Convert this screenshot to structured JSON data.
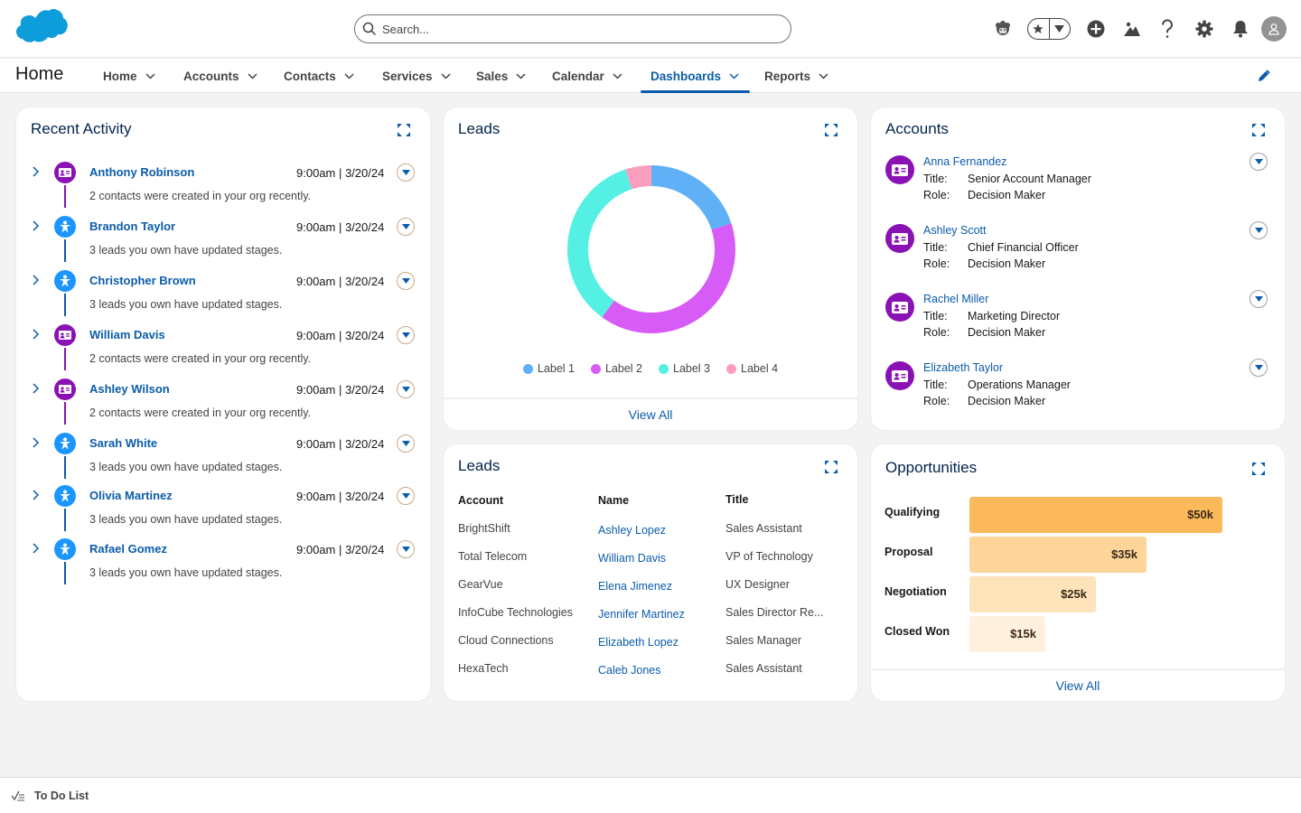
{
  "header": {
    "search_placeholder": "Search...",
    "icons": [
      "einstein-icon",
      "favorites-star-icon",
      "favorites-dropdown-icon",
      "add-icon",
      "trailhead-icon",
      "help-icon",
      "settings-icon",
      "notifications-bell-icon",
      "user-avatar-icon"
    ]
  },
  "nav": {
    "app_name": "Home",
    "items": [
      {
        "label": "Home"
      },
      {
        "label": "Accounts"
      },
      {
        "label": "Contacts"
      },
      {
        "label": "Services"
      },
      {
        "label": "Sales"
      },
      {
        "label": "Calendar"
      },
      {
        "label": "Dashboards",
        "active": true
      },
      {
        "label": "Reports"
      }
    ]
  },
  "recent_activity": {
    "title": "Recent Activity",
    "items": [
      {
        "name": "Anthony Robinson",
        "time": "9:00am | 3/20/24",
        "desc": "2 contacts were created in your org recently.",
        "type": "contact"
      },
      {
        "name": "Brandon Taylor",
        "time": "9:00am | 3/20/24",
        "desc": "3 leads you own have updated stages.",
        "type": "lead"
      },
      {
        "name": "Christopher Brown",
        "time": "9:00am | 3/20/24",
        "desc": "3 leads you own have updated stages.",
        "type": "lead"
      },
      {
        "name": "William Davis",
        "time": "9:00am | 3/20/24",
        "desc": "2 contacts were created in your org recently.",
        "type": "contact"
      },
      {
        "name": "Ashley Wilson",
        "time": "9:00am | 3/20/24",
        "desc": "2 contacts were created in your org recently.",
        "type": "contact"
      },
      {
        "name": "Sarah White",
        "time": "9:00am | 3/20/24",
        "desc": "3 leads you own have updated stages.",
        "type": "lead"
      },
      {
        "name": "Olivia Martinez",
        "time": "9:00am | 3/20/24",
        "desc": "3 leads you own have updated stages.",
        "type": "lead"
      },
      {
        "name": "Rafael Gomez",
        "time": "9:00am | 3/20/24",
        "desc": "3 leads you own have updated stages.",
        "type": "lead"
      }
    ],
    "colors": {
      "contact": "#8a12b5",
      "lead": "#1b96ff"
    }
  },
  "leads_chart": {
    "title": "Leads",
    "view_all": "View All",
    "chart_data": {
      "type": "pie",
      "variant": "donut",
      "title": "Leads",
      "categories": [
        "Label 1",
        "Label 2",
        "Label 3",
        "Label 4"
      ],
      "values": [
        20,
        40,
        35,
        5
      ],
      "colors": [
        "#5fb0f7",
        "#d75cf6",
        "#55f0e4",
        "#fb9ebd"
      ],
      "legend": "bottom"
    }
  },
  "accounts": {
    "title": "Accounts",
    "title_label": "Title:",
    "role_label": "Role:",
    "items": [
      {
        "name": "Anna Fernandez",
        "title": "Senior Account Manager",
        "role": "Decision Maker"
      },
      {
        "name": "Ashley Scott",
        "title": "Chief Financial Officer",
        "role": "Decision Maker"
      },
      {
        "name": "Rachel Miller",
        "title": "Marketing Director",
        "role": "Decision Maker"
      },
      {
        "name": "Elizabeth Taylor",
        "title": "Operations Manager",
        "role": "Decision Maker"
      }
    ]
  },
  "leads_table": {
    "title": "Leads",
    "columns": [
      "Account",
      "Name",
      "Title"
    ],
    "rows": [
      [
        "BrightShift",
        "Ashley Lopez",
        "Sales Assistant"
      ],
      [
        "Total Telecom",
        "William Davis",
        "VP of Technology"
      ],
      [
        "GearVue",
        "Elena Jimenez",
        "UX Designer"
      ],
      [
        "InfoCube Technologies",
        "Jennifer Martinez",
        "Sales Director Re..."
      ],
      [
        "Cloud Connections",
        "Elizabeth Lopez",
        "Sales Manager"
      ],
      [
        "HexaTech",
        "Caleb Jones",
        "Sales Assistant"
      ]
    ]
  },
  "opportunities": {
    "title": "Opportunities",
    "view_all": "View All",
    "chart_data": {
      "type": "bar",
      "orientation": "horizontal",
      "title": "Opportunities",
      "categories": [
        "Qualifying",
        "Proposal",
        "Negotiation",
        "Closed Won"
      ],
      "values": [
        50,
        35,
        25,
        15
      ],
      "labels": [
        "$50k",
        "$35k",
        "$25k",
        "$15k"
      ],
      "unit": "$k",
      "colors": [
        "#fcb95b",
        "#fdd49a",
        "#fee3bb",
        "#fff1dd"
      ]
    }
  },
  "footer": {
    "label": "To Do List"
  }
}
